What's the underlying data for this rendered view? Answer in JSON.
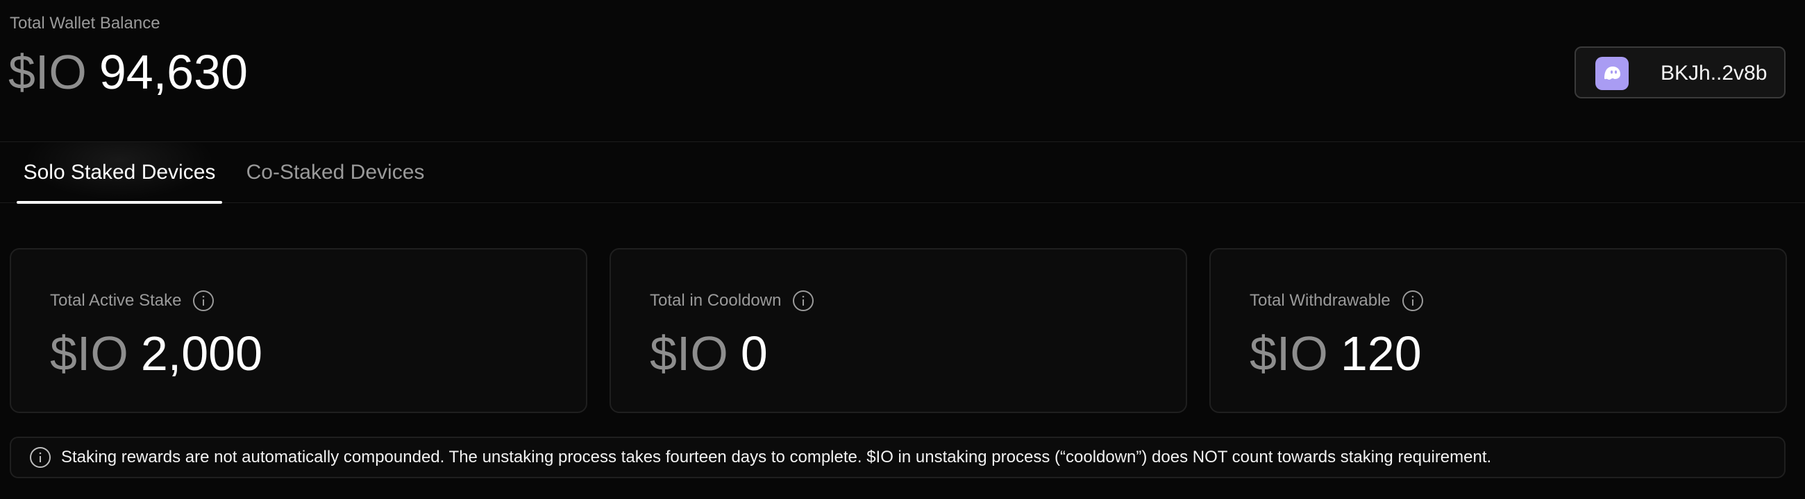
{
  "header": {
    "balance_label": "Total Wallet Balance",
    "currency": "$IO",
    "balance_value": "94,630",
    "wallet": {
      "address": "BKJh..2v8b",
      "avatar_icon": "ghost-icon",
      "avatar_color": "#a99cf3"
    }
  },
  "tabs": [
    {
      "label": "Solo Staked Devices",
      "active": true
    },
    {
      "label": "Co-Staked Devices",
      "active": false
    }
  ],
  "stats": [
    {
      "label": "Total Active Stake",
      "currency": "$IO",
      "value": "2,000",
      "icon": "info-icon"
    },
    {
      "label": "Total in Cooldown",
      "currency": "$IO",
      "value": "0",
      "icon": "info-icon"
    },
    {
      "label": "Total Withdrawable",
      "currency": "$IO",
      "value": "120",
      "icon": "info-icon"
    }
  ],
  "notice": {
    "icon": "info-icon",
    "text": "Staking rewards are not automatically compounded. The unstaking process takes fourteen days to complete. $IO in unstaking process (“cooldown”) does NOT count towards staking requirement."
  },
  "colors": {
    "background": "#070707",
    "card_background": "#0c0c0c",
    "muted_text": "#9a9a9a",
    "currency_text": "#8e8e8e",
    "primary_text": "#ffffff"
  }
}
